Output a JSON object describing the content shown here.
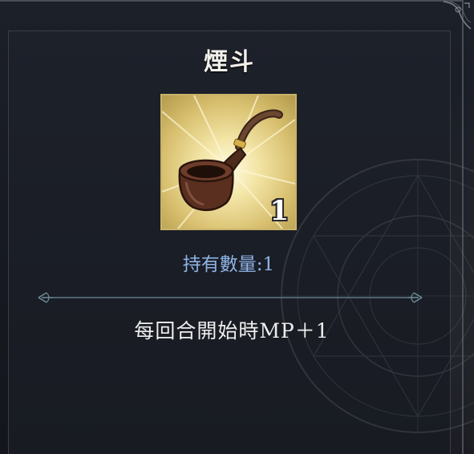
{
  "item": {
    "name": "煙斗",
    "icon": "tobacco-pipe-icon",
    "stack_count": "1",
    "owned_label": "持有數量:1",
    "description": "每回合開始時MP＋1"
  },
  "colors": {
    "title": "#f2f0ea",
    "owned": "#8fb4e6",
    "description": "#eeeeee",
    "card_border": "#c9b36a",
    "divider": "#5d7a86"
  }
}
